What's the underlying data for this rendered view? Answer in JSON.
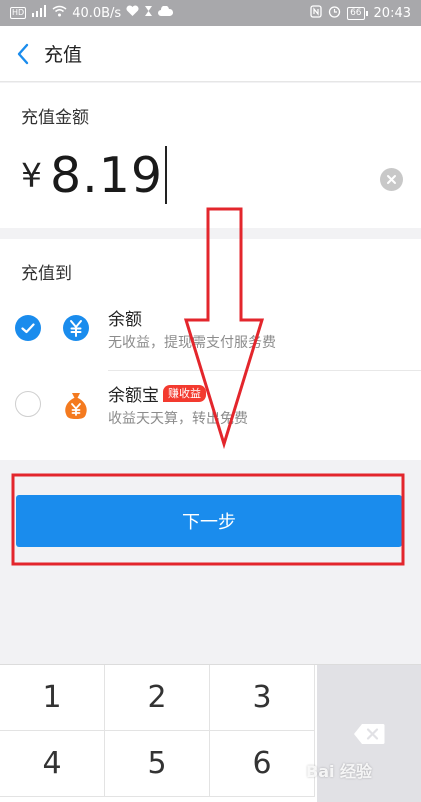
{
  "status_bar": {
    "network_speed": "40.0B/s",
    "battery": "66",
    "time": "20:43",
    "hd": "HD"
  },
  "header": {
    "back_icon": "chevron-left-icon",
    "title": "充值"
  },
  "amount": {
    "label": "充值金额",
    "currency": "¥",
    "value": "8.19"
  },
  "recharge_to": {
    "label": "充值到",
    "methods": [
      {
        "title": "余额",
        "description": "无收益，提现需支付服务费",
        "selected": true,
        "icon": "yuan-coin-icon"
      },
      {
        "title": "余额宝",
        "badge": "赚收益",
        "description": "收益天天算，转出免费",
        "selected": false,
        "icon": "money-bag-icon"
      }
    ]
  },
  "next_button": {
    "label": "下一步"
  },
  "keypad": {
    "keys": [
      "1",
      "2",
      "3",
      "4",
      "5",
      "6"
    ]
  },
  "watermark": {
    "text": "Bai 经验"
  },
  "colors": {
    "accent": "#1a8ced",
    "annotation": "#e3262c",
    "badge": "#f33a2f",
    "wealth": "#f47a1f"
  }
}
